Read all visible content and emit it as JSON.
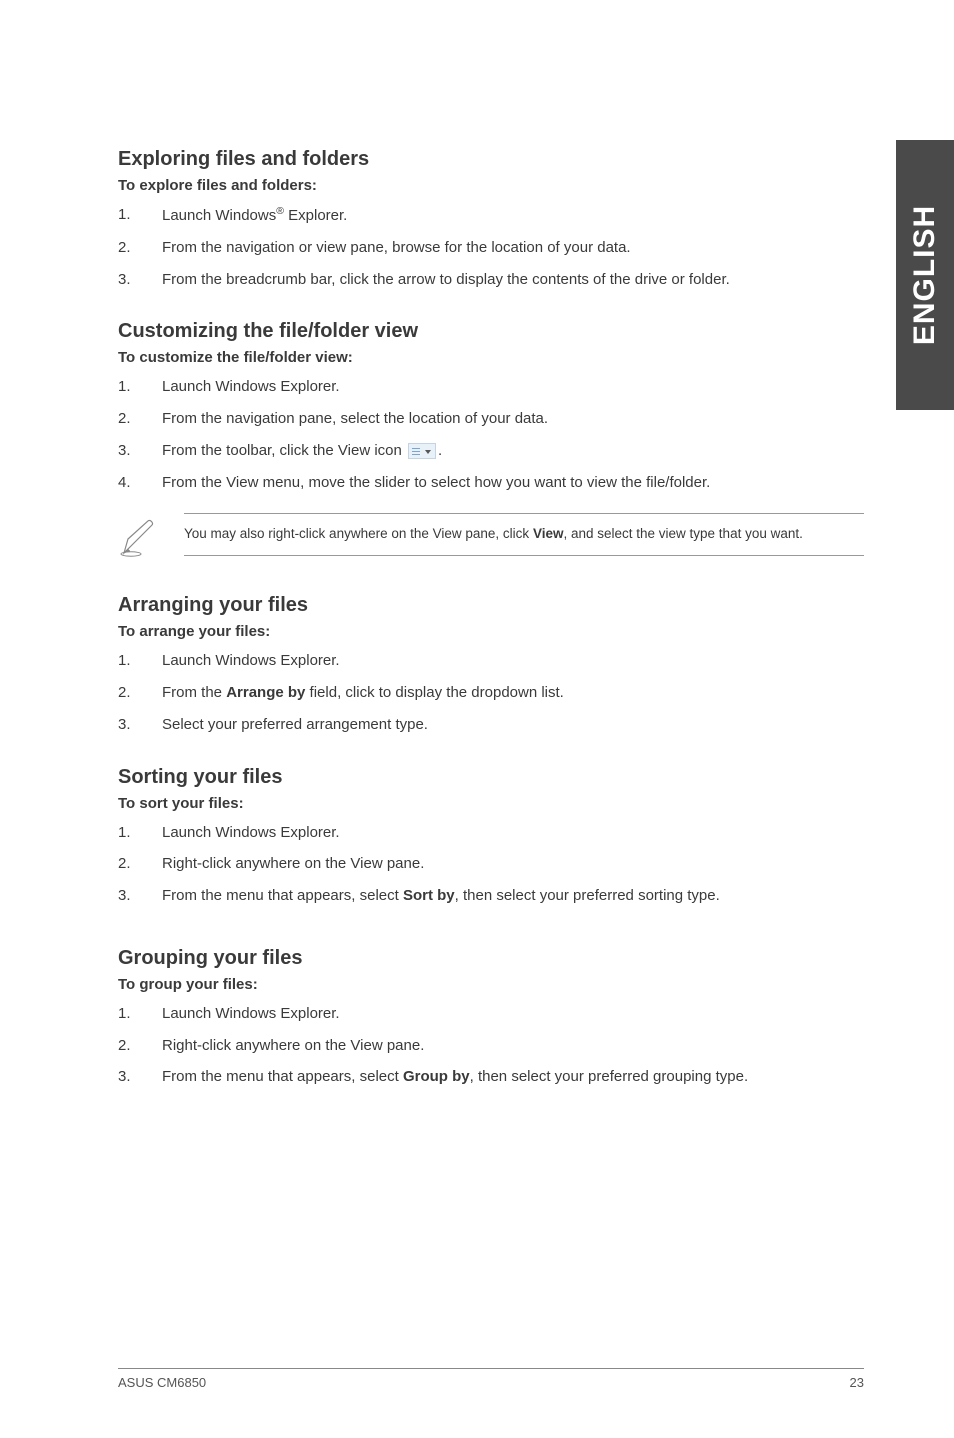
{
  "side_tab": "ENGLISH",
  "sections": {
    "exploring": {
      "title": "Exploring files and folders",
      "sub": "To explore files and folders:",
      "steps": [
        {
          "num": "1.",
          "pre": "Launch Windows",
          "sup": "®",
          "post": " Explorer."
        },
        {
          "num": "2.",
          "text": "From the navigation or view pane, browse for the location of your data."
        },
        {
          "num": "3.",
          "text": "From the breadcrumb bar, click the arrow to display the contents of the drive or folder."
        }
      ]
    },
    "customizing": {
      "title": "Customizing the file/folder view",
      "sub": "To customize the file/folder view:",
      "steps": [
        {
          "num": "1.",
          "text": "Launch Windows Explorer."
        },
        {
          "num": "2.",
          "text": "From the navigation pane, select the location of your data."
        },
        {
          "num": "3.",
          "text_pre": "From the toolbar, click the View icon ",
          "has_icon": true,
          "text_post": "."
        },
        {
          "num": "4.",
          "text": "From the View menu, move the slider to select how you want to view the file/folder."
        }
      ],
      "note_pre": "You may also right-click anywhere on the View pane, click ",
      "note_bold": "View",
      "note_post": ", and select the view type that you want."
    },
    "arranging": {
      "title": "Arranging your files",
      "sub": "To arrange your files:",
      "steps": [
        {
          "num": "1.",
          "text": "Launch Windows Explorer."
        },
        {
          "num": "2.",
          "text_pre": "From the ",
          "bold": "Arrange by",
          "text_post": " field, click to display the dropdown list."
        },
        {
          "num": "3.",
          "text": "Select your preferred arrangement type."
        }
      ]
    },
    "sorting": {
      "title": "Sorting your files",
      "sub": "To sort your files:",
      "steps": [
        {
          "num": "1.",
          "text": "Launch Windows Explorer."
        },
        {
          "num": "2.",
          "text": "Right-click anywhere on the View pane."
        },
        {
          "num": "3.",
          "text_pre": "From the menu that appears, select ",
          "bold": "Sort by",
          "text_post": ", then select your preferred sorting type."
        }
      ]
    },
    "grouping": {
      "title": "Grouping your files",
      "sub": "To group your files:",
      "steps": [
        {
          "num": "1.",
          "text": "Launch Windows Explorer."
        },
        {
          "num": "2.",
          "text": "Right-click anywhere on the View pane."
        },
        {
          "num": "3.",
          "text_pre": "From the menu that appears, select ",
          "bold": "Group by",
          "text_post": ", then select your preferred grouping type."
        }
      ]
    }
  },
  "footer": {
    "left": "ASUS CM6850",
    "right": "23"
  }
}
